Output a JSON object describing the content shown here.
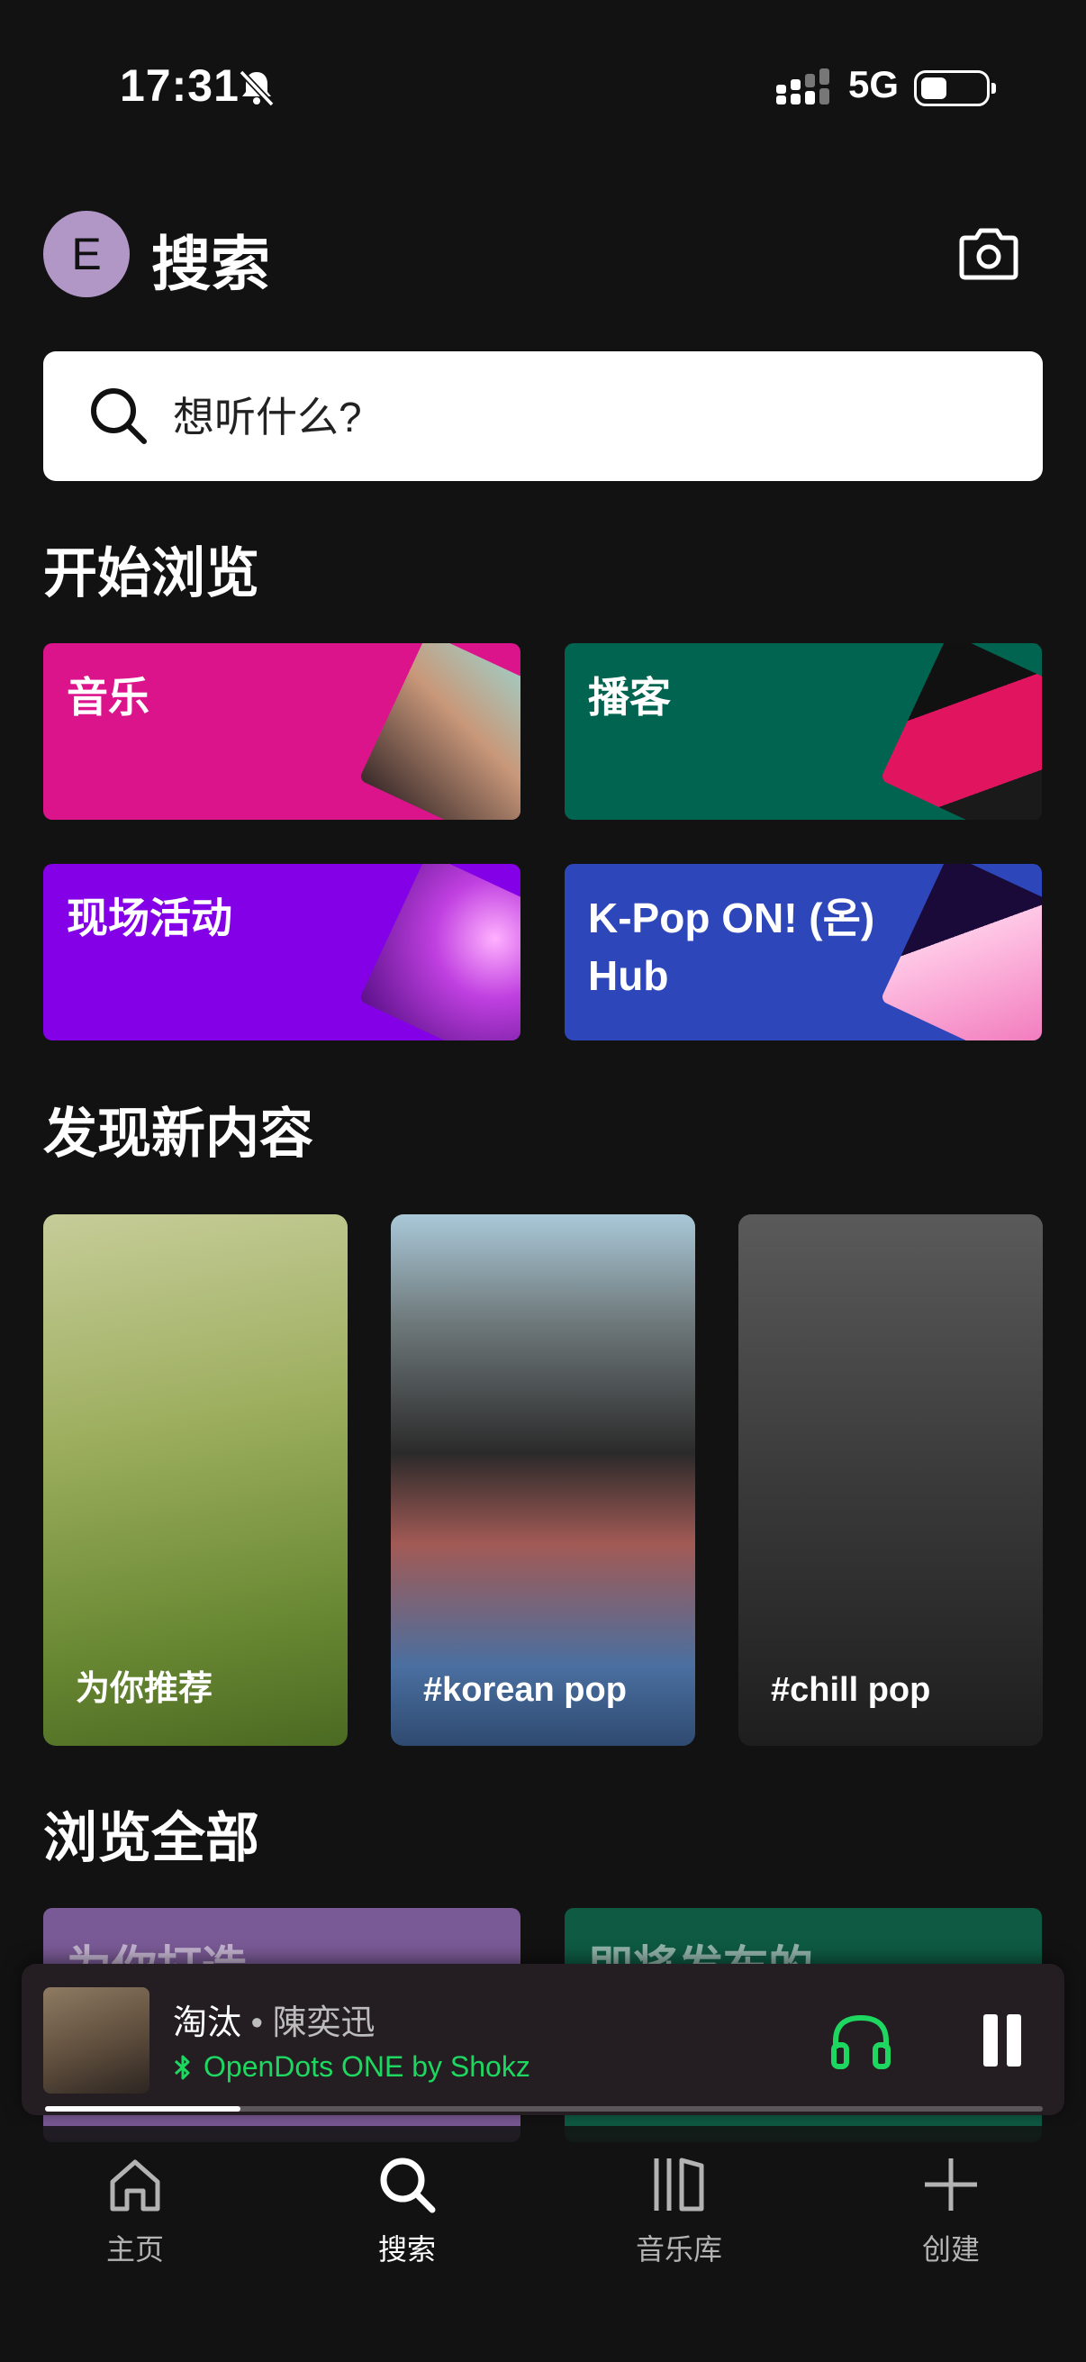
{
  "status_bar": {
    "time": "17:31",
    "network": "5G"
  },
  "header": {
    "avatar_letter": "E",
    "title": "搜索",
    "camera_icon": "camera-icon"
  },
  "search": {
    "placeholder": "想听什么?"
  },
  "browse": {
    "title": "开始浏览",
    "tiles": [
      {
        "label": "音乐",
        "color": "#dc148c"
      },
      {
        "label": "播客",
        "color": "#006450"
      },
      {
        "label": "现场活动",
        "color": "#8400e7"
      },
      {
        "label": "K-Pop ON! (온) Hub",
        "color": "#2d46b9"
      }
    ]
  },
  "discover": {
    "title": "发现新内容",
    "cards": [
      {
        "label": "为你推荐"
      },
      {
        "label": "#korean pop"
      },
      {
        "label": "#chill pop"
      }
    ]
  },
  "browse_all": {
    "title": "浏览全部",
    "cards": [
      {
        "label": "为你打造",
        "color": "#7a5a96"
      },
      {
        "label": "即将发布的",
        "color": "#0e5a42"
      }
    ]
  },
  "player": {
    "track": "淘汰",
    "separator": " • ",
    "artist": "陳奕迅",
    "device": "OpenDots ONE by Shokz",
    "progress": 0.196
  },
  "nav": [
    {
      "label": "主页",
      "icon": "home-icon"
    },
    {
      "label": "搜索",
      "icon": "search-icon",
      "active": true
    },
    {
      "label": "音乐库",
      "icon": "library-icon"
    },
    {
      "label": "创建",
      "icon": "plus-icon"
    }
  ],
  "colors": {
    "accent": "#1ed760",
    "background": "#121212"
  }
}
